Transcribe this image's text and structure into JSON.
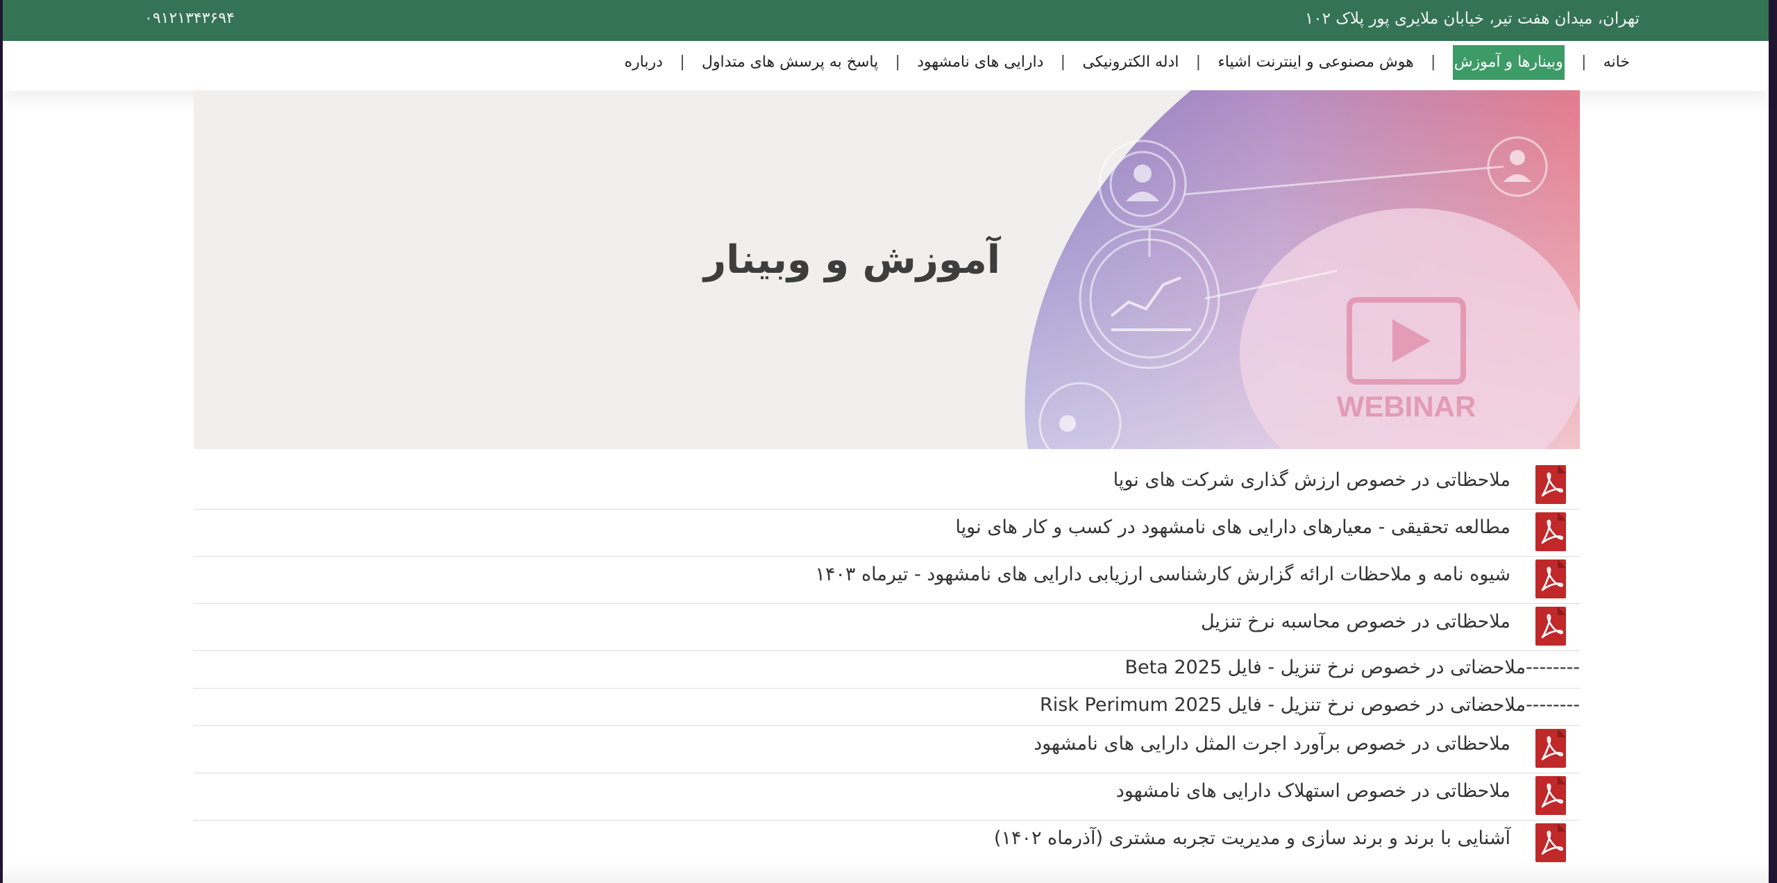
{
  "topbar": {
    "address": "تهران، میدان هفت تیر، خیابان ملایری پور پلاک ۱۰۲",
    "phone": "۰۹۱۲۱۳۴۳۶۹۴"
  },
  "nav": {
    "items": [
      {
        "label": "خانه",
        "active": false
      },
      {
        "label": "وبینارها و آموزش",
        "active": true
      },
      {
        "label": "هوش مصنوعی و اینترنت اشیاء",
        "active": false
      },
      {
        "label": "ادله الکترونیکی",
        "active": false
      },
      {
        "label": "دارایی های نامشهود",
        "active": false
      },
      {
        "label": "پاسخ به پرسش های متداول",
        "active": false
      },
      {
        "label": "درباره",
        "active": false
      }
    ],
    "separator": "|",
    "active_color": "#3d9b68"
  },
  "hero": {
    "title": "آموزش و وبینار",
    "image_label": "WEBINAR"
  },
  "documents": [
    {
      "title": "ملاحظاتی در خصوص ارزش گذاری شرکت های نوپا",
      "icon": "pdf-icon"
    },
    {
      "title": "مطالعه تحقیقی - معیارهای دارایی های نامشهود در کسب و کار های نوپا",
      "icon": "pdf-icon"
    },
    {
      "title": "شیوه نامه و ملاحظات ارائه گزارش کارشناسی ارزیابی دارایی های نامشهود - تیرماه ۱۴۰۳",
      "icon": "pdf-icon"
    },
    {
      "title": "ملاحظاتی در خصوص محاسبه نرخ تنزیل",
      "icon": "pdf-icon"
    },
    {
      "title": "--------ملاحضاتی در خصوص نرخ تنزیل - فایل Beta 2025",
      "icon": "none"
    },
    {
      "title": "--------ملاحضاتی در خصوص نرخ تنزیل - فایل Risk Perimum 2025",
      "icon": "none"
    },
    {
      "title": "ملاحظاتی در خصوص برآورد اجرت المثل دارایی های نامشهود",
      "icon": "pdf-icon"
    },
    {
      "title": "ملاحظاتی در خصوص استهلاک دارایی های نامشهود",
      "icon": "pdf-icon"
    },
    {
      "title": "آشنایی با برند و برند سازی و مدیریت تجربه مشتری (آذرماه ۱۴۰۲)",
      "icon": "pdf-icon"
    }
  ],
  "colors": {
    "topbar": "#357355",
    "pdf_red": "#c0282a",
    "hero_bg": "#f0efee"
  }
}
